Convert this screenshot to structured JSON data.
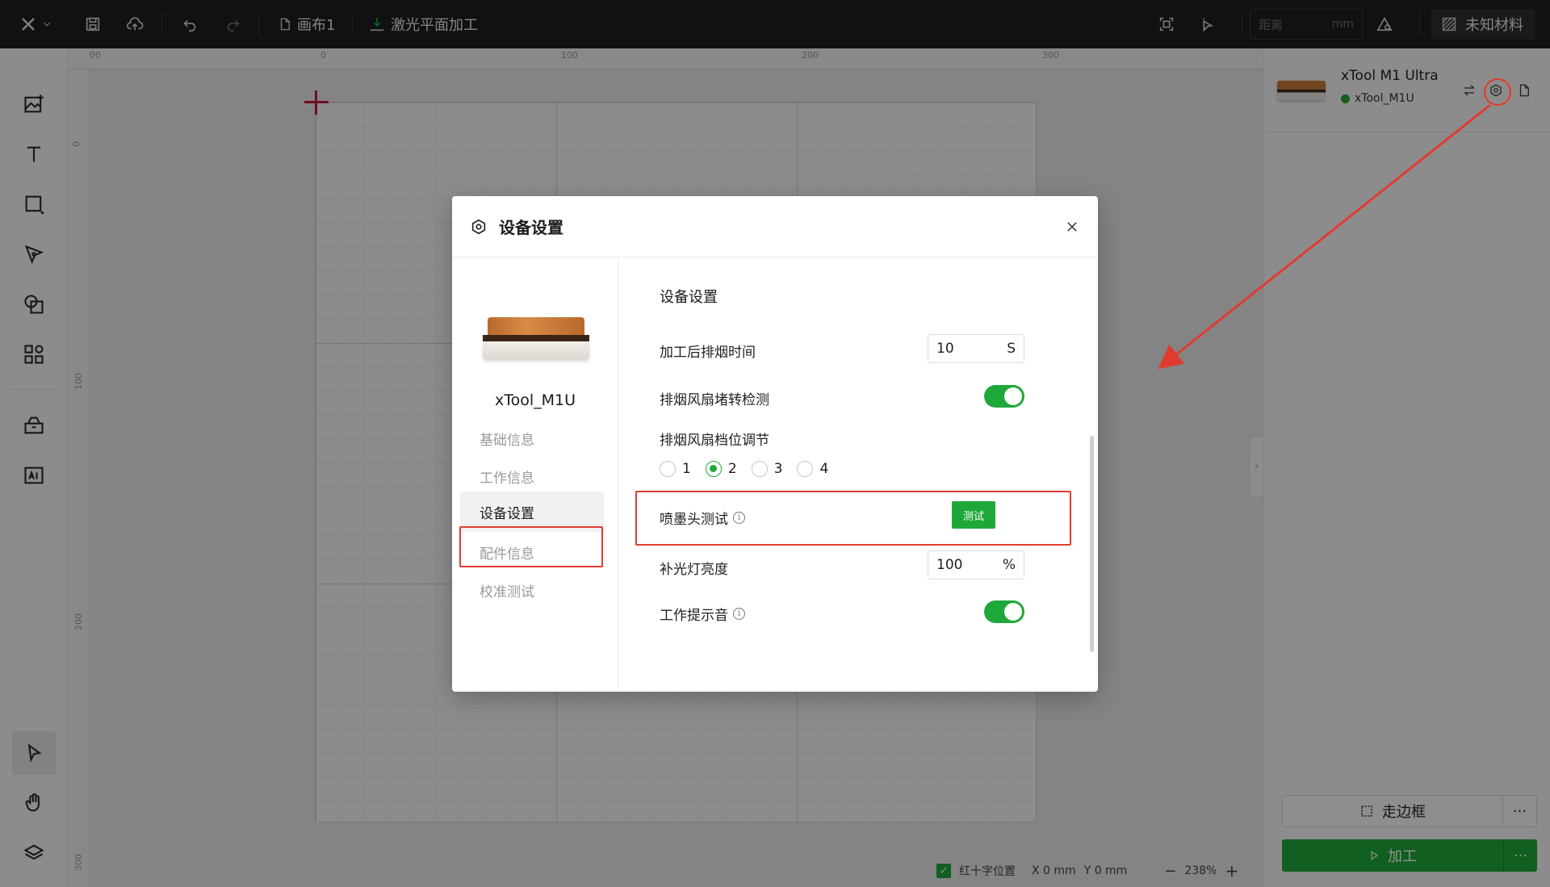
{
  "topbar": {
    "canvas_name": "画布1",
    "mode": "激光平面加工",
    "distance_placeholder": "距离",
    "distance_unit": "mm",
    "material": "未知材料"
  },
  "rulers": {
    "top": [
      "00",
      "0",
      "100",
      "200",
      "300"
    ],
    "left": [
      "0",
      "100",
      "200",
      "300"
    ]
  },
  "device_panel": {
    "name": "xTool M1 Ultra",
    "status": "xTool_M1U",
    "status_color": "#22a834",
    "frame_button": "走边框",
    "process_button": "加工"
  },
  "statusbar": {
    "crosshair_label": "红十字位置",
    "x": "X 0 mm",
    "y": "Y 0 mm",
    "zoom": "238%"
  },
  "modal": {
    "title": "设备设置",
    "device_name": "xTool_M1U",
    "sidebar": [
      {
        "label": "基础信息",
        "active": false
      },
      {
        "label": "工作信息",
        "active": false
      },
      {
        "label": "设备设置",
        "active": true
      },
      {
        "label": "配件信息",
        "active": false
      },
      {
        "label": "校准测试",
        "active": false
      }
    ],
    "section_title": "设备设置",
    "smoke_time": {
      "label": "加工后排烟时间",
      "value": "10",
      "unit": "S"
    },
    "fan_detect": {
      "label": "排烟风扇堵转检测",
      "on": true
    },
    "fan_level": {
      "label": "排烟风扇档位调节",
      "options": [
        "1",
        "2",
        "3",
        "4"
      ],
      "selected": "2"
    },
    "nozzle_test": {
      "label": "喷墨头测试",
      "button": "测试"
    },
    "fill_light": {
      "label": "补光灯亮度",
      "value": "100",
      "unit": "%"
    },
    "work_sound": {
      "label": "工作提示音",
      "on": true
    }
  },
  "colors": {
    "accent": "#1fa83a",
    "highlight": "#e13b2f"
  }
}
